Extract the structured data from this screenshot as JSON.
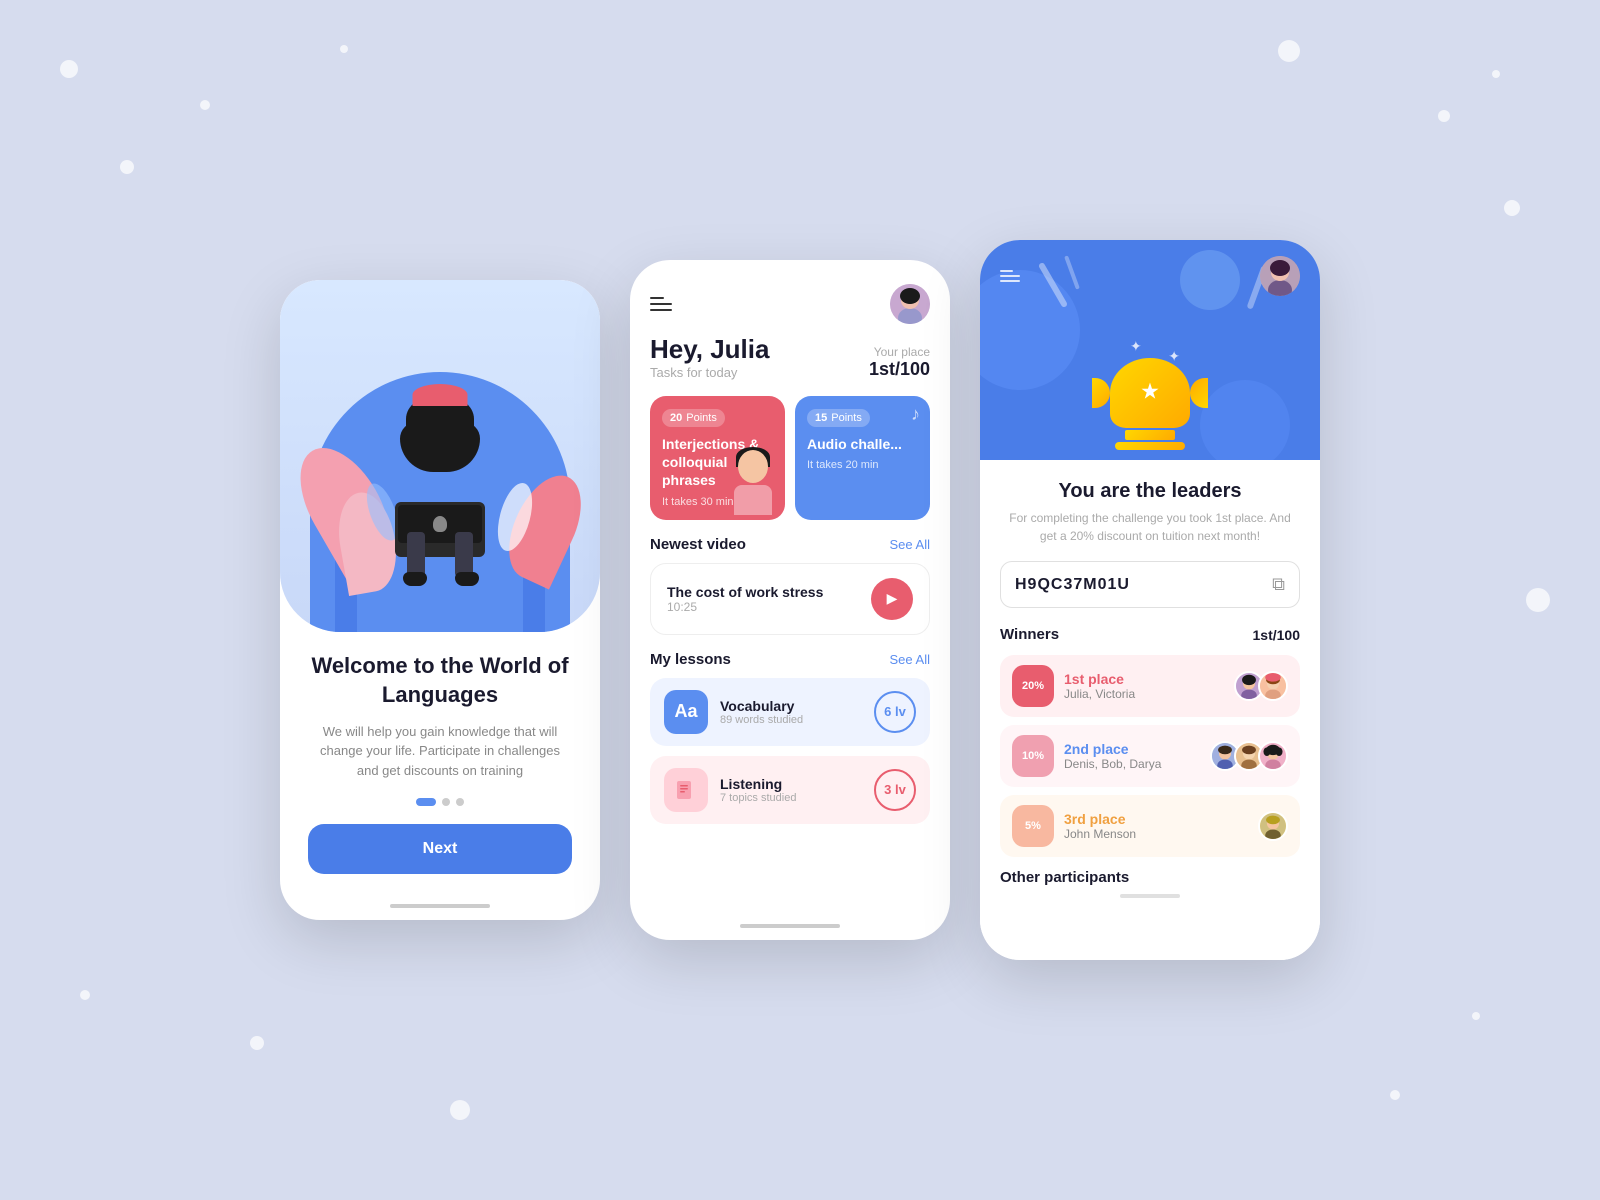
{
  "background": {
    "color": "#d6dcee"
  },
  "phone1": {
    "title": "Welcome to the World of Languages",
    "subtitle": "We will help you gain knowledge that will change your life. Participate in challenges and get discounts on training",
    "next_button": "Next",
    "pagination": [
      "active",
      "inactive",
      "inactive"
    ]
  },
  "phone2": {
    "header": {
      "greeting": "Hey, Julia",
      "tasks_label": "Tasks for today",
      "your_place_label": "Your place",
      "place_value": "1st/100"
    },
    "cards": [
      {
        "points": "20",
        "points_label": "Points",
        "title": "Interjections & colloquial phrases",
        "time": "It takes 30 min"
      },
      {
        "points": "15",
        "points_label": "Points",
        "title": "Audio challe...",
        "time": "It takes 20 min"
      }
    ],
    "newest_video": {
      "section_title": "Newest video",
      "see_all": "See All",
      "title": "The cost of work stress",
      "duration": "10:25"
    },
    "my_lessons": {
      "section_title": "My lessons",
      "see_all": "See All",
      "items": [
        {
          "name": "Vocabulary",
          "sub": "89 words studied",
          "level": "6 lv",
          "icon": "Aa"
        },
        {
          "name": "Listening",
          "sub": "7 topics studied",
          "level": "3 lv",
          "icon": "📄"
        }
      ]
    }
  },
  "phone3": {
    "hero_title": "You are the leaders",
    "hero_sub": "For completing the challenge you took 1st place. And get a 20% discount on tuition next month!",
    "promo_code": "H9QC37M01U",
    "winners_label": "Winners",
    "winners_place": "1st/100",
    "places": [
      {
        "discount": "20%",
        "label": "1st place",
        "names": "Julia, Victoria",
        "avatars": 2
      },
      {
        "discount": "10%",
        "label": "2nd place",
        "names": "Denis, Bob, Darya",
        "avatars": 3
      },
      {
        "discount": "5%",
        "label": "3rd place",
        "names": "John Menson",
        "avatars": 1
      }
    ],
    "other_participants": "Other participants"
  }
}
